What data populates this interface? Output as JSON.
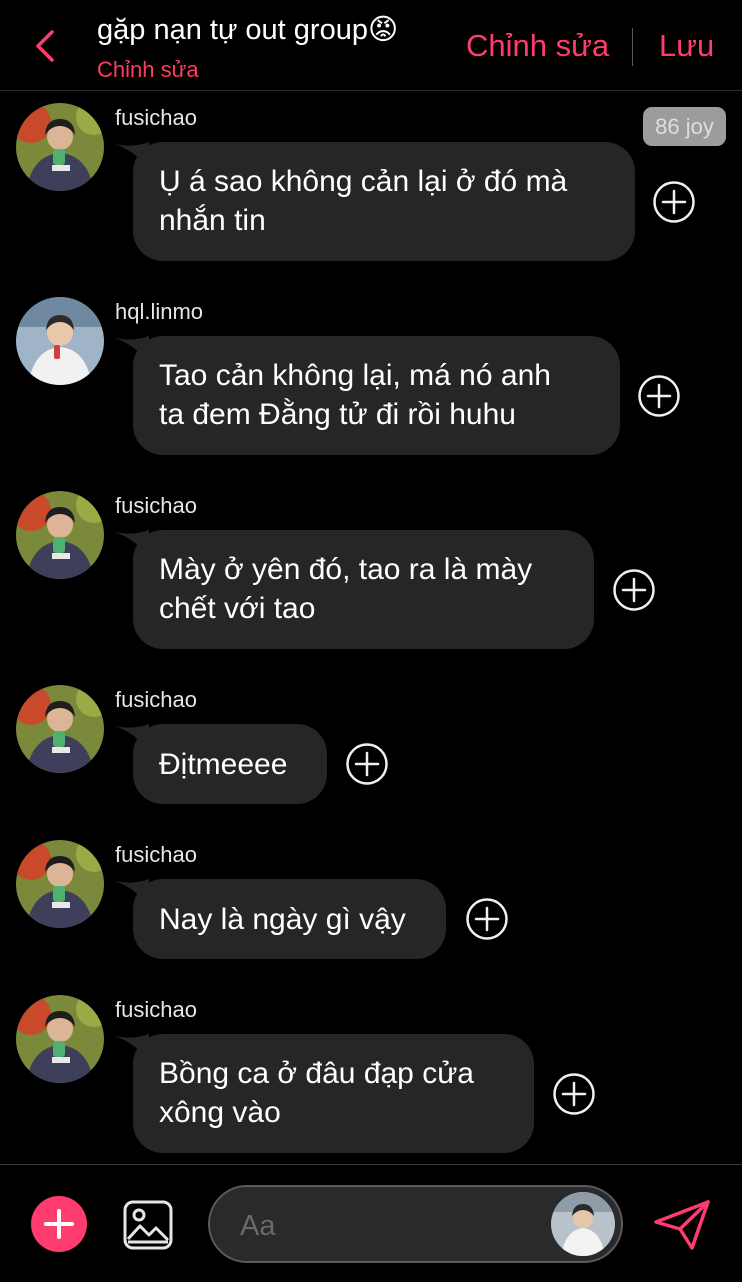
{
  "header": {
    "title": "gặp nạn tự out group",
    "title_emoji": "😡",
    "subtitle": "Chỉnh sửa",
    "edit_label": "Chỉnh sửa",
    "save_label": "Lưu",
    "accent": "#ff3c6e"
  },
  "joy_badge": "86 joy",
  "messages": [
    {
      "user": "fusichao",
      "lines": [
        "Ụ á sao không cản lại ở đó mà",
        "nhắn tin"
      ]
    },
    {
      "user": "hql.linmo",
      "lines": [
        "Tao cản không lại, má nó anh",
        "ta đem Đằng tử đi rồi huhu"
      ]
    },
    {
      "user": "fusichao",
      "lines": [
        "Mày ở yên đó, tao ra là mày",
        "chết với tao"
      ]
    },
    {
      "user": "fusichao",
      "lines": [
        "Địtmeeee"
      ]
    },
    {
      "user": "fusichao",
      "lines": [
        "Nay là ngày gì vậy"
      ]
    },
    {
      "user": "fusichao",
      "lines": [
        "Bồng ca ở đâu đạp cửa",
        "xông vào"
      ]
    }
  ],
  "composer": {
    "placeholder": "Aa",
    "icons": [
      "plus-icon",
      "image-icon",
      "send-icon"
    ]
  }
}
